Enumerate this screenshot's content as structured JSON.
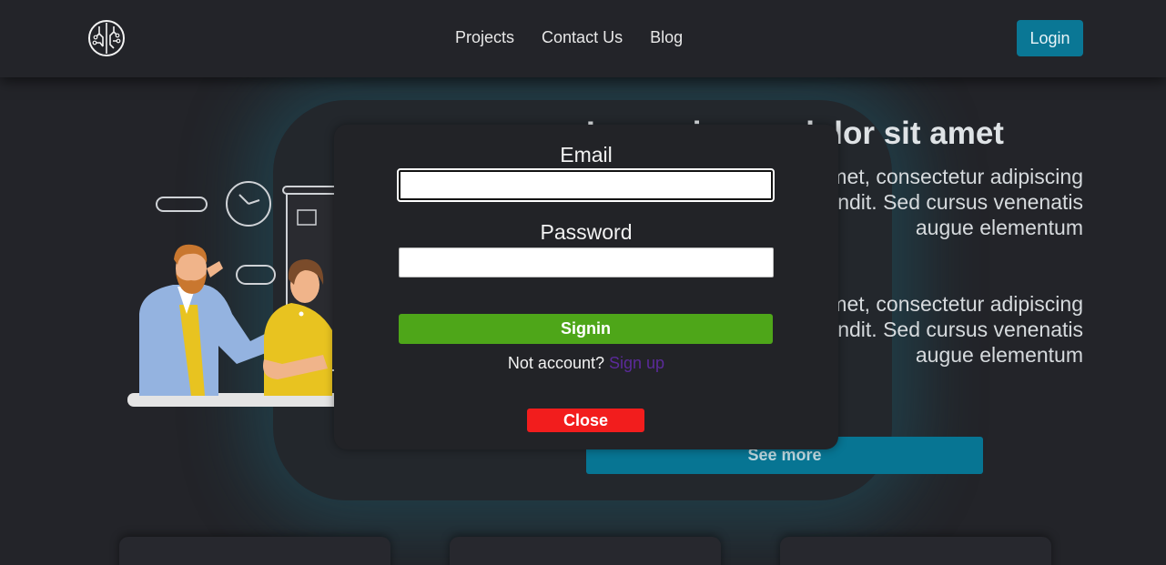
{
  "navbar": {
    "logo_icon": "circuit-brain-icon",
    "links": [
      "Projects",
      "Contact Us",
      "Blog"
    ],
    "login_label": "Login"
  },
  "hero": {
    "title": "Lorem ipsum dolor sit amet",
    "paragraph_1": "Lorem ipsum dolor sit amet, consectetur adipiscing elit. Integer facilisis blandit. Sed cursus venenatis augue elementum",
    "paragraph_2": "Lorem ipsum dolor sit amet, consectetur adipiscing elit. Integer facilisis blandit. Sed cursus venenatis augue elementum",
    "see_more_label": "See more"
  },
  "modal": {
    "email_label": "Email",
    "email_value": "",
    "password_label": "Password",
    "password_value": "",
    "signin_label": "Signin",
    "no_account_text": "Not account?",
    "signup_link": "Sign up",
    "close_label": "Close"
  },
  "colors": {
    "background": "#232429",
    "accent": "#0a7795",
    "signin": "#4ea619",
    "close": "#f21d1d",
    "signup_link": "#5b2a9a"
  }
}
